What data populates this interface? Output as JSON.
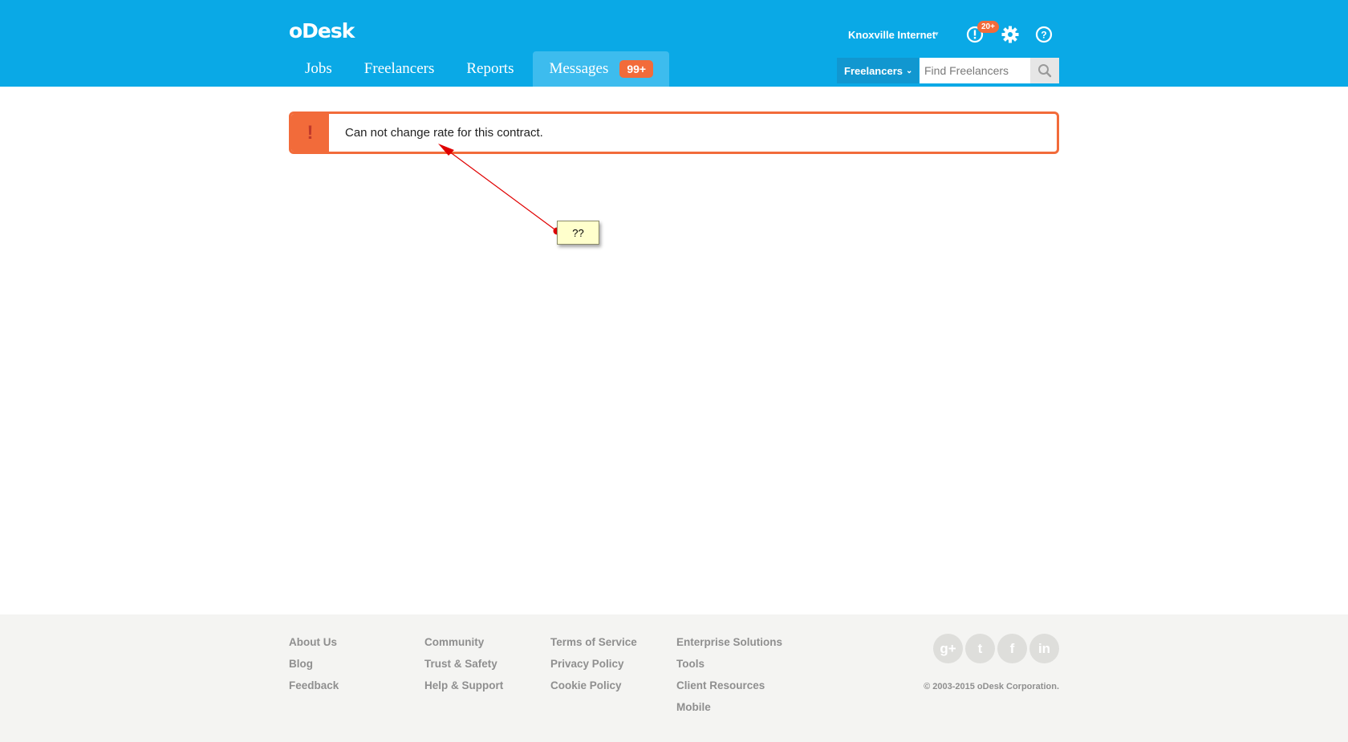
{
  "header": {
    "logo": "oDesk",
    "nav": [
      {
        "label": "Jobs"
      },
      {
        "label": "Freelancers"
      },
      {
        "label": "Reports"
      },
      {
        "label": "Messages",
        "badge": "99+"
      }
    ],
    "user_name": "Knoxville Internet",
    "notifications_badge": "20+",
    "search": {
      "scope": "Freelancers",
      "placeholder": "Find Freelancers"
    }
  },
  "alert": {
    "message": "Can not change rate for this contract."
  },
  "annotation": {
    "note": "??",
    "color": "#e00000"
  },
  "footer": {
    "col1": [
      "About Us",
      "Blog",
      "Feedback"
    ],
    "col2": [
      "Community",
      "Trust & Safety",
      "Help & Support"
    ],
    "col3": [
      "Terms of Service",
      "Privacy Policy",
      "Cookie Policy"
    ],
    "col4": [
      "Enterprise Solutions",
      "Tools",
      "Client Resources",
      "Mobile"
    ],
    "social": [
      "google-plus-icon",
      "twitter-icon",
      "facebook-icon",
      "linkedin-icon"
    ],
    "copyright": "© 2003-2015 oDesk Corporation."
  },
  "colors": {
    "header_bg": "#0aa9e6",
    "accent": "#f26b3a",
    "footer_bg": "#f4f4f2"
  }
}
